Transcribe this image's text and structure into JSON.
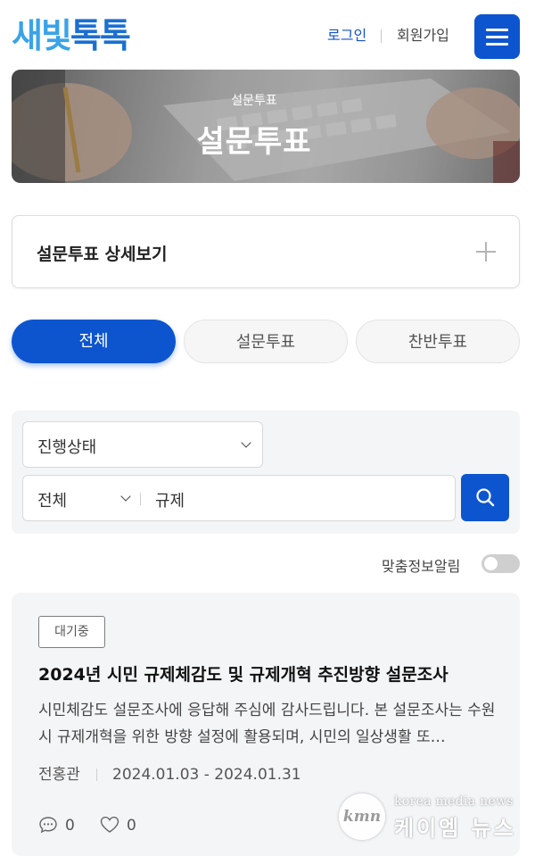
{
  "header": {
    "logo_part1": "새빛",
    "logo_part2": "톡톡",
    "login": "로그인",
    "signup": "회원가입",
    "menu_icon": "hamburger-menu-icon"
  },
  "banner": {
    "subtitle": "설문투표",
    "title": "설문투표"
  },
  "detail": {
    "label": "설문투표 상세보기",
    "icon": "plus-icon"
  },
  "tabs": [
    {
      "label": "전체",
      "active": true
    },
    {
      "label": "설문투표",
      "active": false
    },
    {
      "label": "찬반투표",
      "active": false
    }
  ],
  "filter": {
    "status_select": "진행상태",
    "scope_select": "전체",
    "query": "규제",
    "search_icon": "search-icon"
  },
  "toggle": {
    "label": "맞춤정보알림",
    "on": false
  },
  "card": {
    "badge": "대기중",
    "title": "2024년 시민 규제체감도 및 규제개혁 추진방향 설문조사",
    "description": "시민체감도 설문조사에 응답해 주심에 감사드립니다.  본 설문조사는 수원시 규제개혁을 위한 방향 설정에 활용되며, 시민의 일상생활 또…",
    "author": "전홍관",
    "period": "2024.01.03 - 2024.01.31",
    "comments": "0",
    "likes": "0"
  },
  "watermark": {
    "logo": "kmn",
    "english": "korea media news",
    "korean": "케이엠 뉴스"
  },
  "colors": {
    "primary": "#0d55cf",
    "logo_light": "#3aa3e8",
    "logo_dark": "#1a6fd1"
  }
}
